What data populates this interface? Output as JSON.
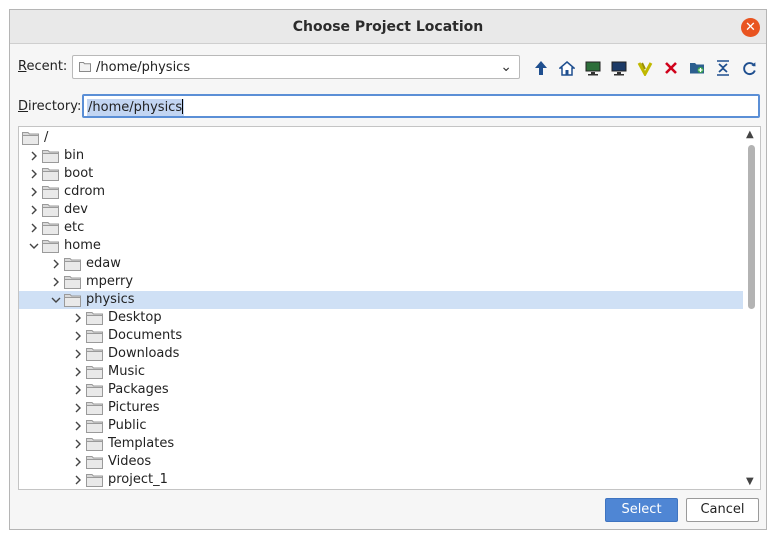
{
  "window": {
    "title": "Choose Project Location"
  },
  "recent": {
    "label_u": "R",
    "label_rest": "ecent:",
    "value": "/home/physics"
  },
  "toolbar": {
    "icons": [
      "up-arrow-icon",
      "home-icon",
      "desktop-icon",
      "computer-icon",
      "vivado-icon",
      "delete-icon",
      "new-folder-icon",
      "collapse-icon",
      "refresh-icon"
    ]
  },
  "directory": {
    "label_u": "D",
    "label_rest": "irectory:",
    "value": "/home/physics"
  },
  "tree": {
    "rows": [
      {
        "name": "/",
        "level": 0,
        "arrow": "none"
      },
      {
        "name": "bin",
        "level": 1,
        "arrow": "right"
      },
      {
        "name": "boot",
        "level": 1,
        "arrow": "right"
      },
      {
        "name": "cdrom",
        "level": 1,
        "arrow": "right"
      },
      {
        "name": "dev",
        "level": 1,
        "arrow": "right"
      },
      {
        "name": "etc",
        "level": 1,
        "arrow": "right"
      },
      {
        "name": "home",
        "level": 1,
        "arrow": "down"
      },
      {
        "name": "edaw",
        "level": 2,
        "arrow": "right"
      },
      {
        "name": "mperry",
        "level": 2,
        "arrow": "right"
      },
      {
        "name": "physics",
        "level": 2,
        "arrow": "down",
        "selected": true
      },
      {
        "name": "Desktop",
        "level": 3,
        "arrow": "right"
      },
      {
        "name": "Documents",
        "level": 3,
        "arrow": "right"
      },
      {
        "name": "Downloads",
        "level": 3,
        "arrow": "right"
      },
      {
        "name": "Music",
        "level": 3,
        "arrow": "right"
      },
      {
        "name": "Packages",
        "level": 3,
        "arrow": "right"
      },
      {
        "name": "Pictures",
        "level": 3,
        "arrow": "right"
      },
      {
        "name": "Public",
        "level": 3,
        "arrow": "right"
      },
      {
        "name": "Templates",
        "level": 3,
        "arrow": "right"
      },
      {
        "name": "Videos",
        "level": 3,
        "arrow": "right"
      },
      {
        "name": "project_1",
        "level": 3,
        "arrow": "right"
      }
    ]
  },
  "buttons": {
    "select": "Select",
    "cancel": "Cancel"
  },
  "colors": {
    "accent": "#4f86d4",
    "close": "#e95420",
    "selection": "#cfe0f5"
  }
}
